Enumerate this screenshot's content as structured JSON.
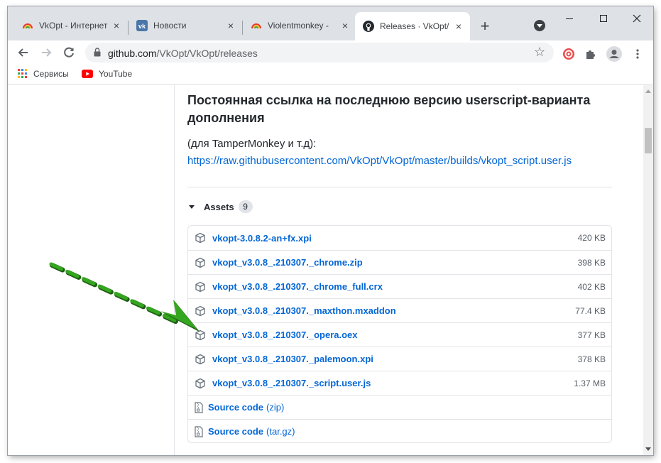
{
  "tabs": [
    {
      "title": "VkOpt - Интернет",
      "close": "×"
    },
    {
      "title": "Новости",
      "close": "×"
    },
    {
      "title": "Violentmonkey - ",
      "close": "×"
    },
    {
      "title": "Releases · VkOpt/",
      "close": "×"
    }
  ],
  "new_tab_label": "+",
  "url": {
    "domain": "github.com",
    "path": "/VkOpt/VkOpt/releases"
  },
  "bookmarks": [
    {
      "label": "Сервисы",
      "icon": "apps-grid-icon"
    },
    {
      "label": "YouTube",
      "icon": "youtube-icon"
    }
  ],
  "release": {
    "permalink_heading": "Постоянная ссылка на последнюю версию userscript-варианта дополнения",
    "note": "(для TamperMonkey и т.д):",
    "script_url": "https://raw.githubusercontent.com/VkOpt/VkOpt/master/builds/vkopt_script.user.js"
  },
  "assets": {
    "label": "Assets",
    "count": "9",
    "files": [
      {
        "name": "vkopt-3.0.8.2-an+fx.xpi",
        "size": "420 KB"
      },
      {
        "name": "vkopt_v3.0.8_.210307._chrome.zip",
        "size": "398 KB"
      },
      {
        "name": "vkopt_v3.0.8_.210307._chrome_full.crx",
        "size": "402 KB"
      },
      {
        "name": "vkopt_v3.0.8_.210307._maxthon.mxaddon",
        "size": "77.4 KB"
      },
      {
        "name": "vkopt_v3.0.8_.210307._opera.oex",
        "size": "377 KB"
      },
      {
        "name": "vkopt_v3.0.8_.210307._palemoon.xpi",
        "size": "378 KB"
      },
      {
        "name": "vkopt_v3.0.8_.210307._script.user.js",
        "size": "1.37 MB"
      }
    ],
    "source": [
      {
        "label": "Source code",
        "format": "(zip)"
      },
      {
        "label": "Source code",
        "format": "(tar.gz)"
      }
    ]
  },
  "colors": {
    "link": "#0366d6",
    "arrow": "#2e9e1a",
    "tabstrip": "#dee1e6"
  }
}
